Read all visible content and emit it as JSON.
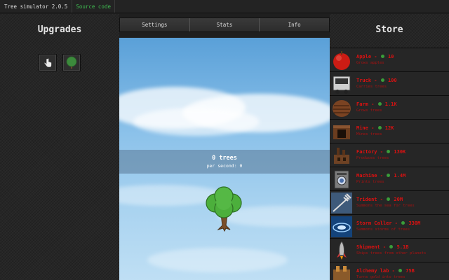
{
  "topbar": {
    "title": "Tree simulator 2.0.5",
    "source_link": "Source code"
  },
  "upgrades": {
    "title": "Upgrades",
    "items": [
      "hand-pointer-icon",
      "tree-icon"
    ]
  },
  "tabs": [
    "Settings",
    "Stats",
    "Info"
  ],
  "counter": {
    "trees": "0 trees",
    "per_second": "per second: 0"
  },
  "store": {
    "title": "Store",
    "items": [
      {
        "name": "Apple",
        "price": "10",
        "desc": "Grows apples",
        "icon": "apple-icon"
      },
      {
        "name": "Truck",
        "price": "100",
        "desc": "Carries trees",
        "icon": "truck-icon"
      },
      {
        "name": "Farm",
        "price": "1.1K",
        "desc": "Grows trees",
        "icon": "farm-icon"
      },
      {
        "name": "Mine",
        "price": "12K",
        "desc": "Mines trees",
        "icon": "mine-icon"
      },
      {
        "name": "Factory",
        "price": "130K",
        "desc": "Produces trees",
        "icon": "factory-icon"
      },
      {
        "name": "Machine",
        "price": "1.4M",
        "desc": "Prints trees",
        "icon": "machine-icon"
      },
      {
        "name": "Trident",
        "price": "20M",
        "desc": "Summons the sea for trees",
        "icon": "trident-icon"
      },
      {
        "name": "Storm Caller",
        "price": "330M",
        "desc": "Summons storms of trees",
        "icon": "storm-icon"
      },
      {
        "name": "Shipment",
        "price": "5.1B",
        "desc": "Ships trees from other planets",
        "icon": "rocket-icon"
      },
      {
        "name": "Alchemy lab",
        "price": "75B",
        "desc": "Turns gold into trees",
        "icon": "alchemy-icon"
      }
    ]
  },
  "colors": {
    "accent_green": "#3fb950",
    "store_red": "#dd1111",
    "sky": "#8cc2ea"
  }
}
